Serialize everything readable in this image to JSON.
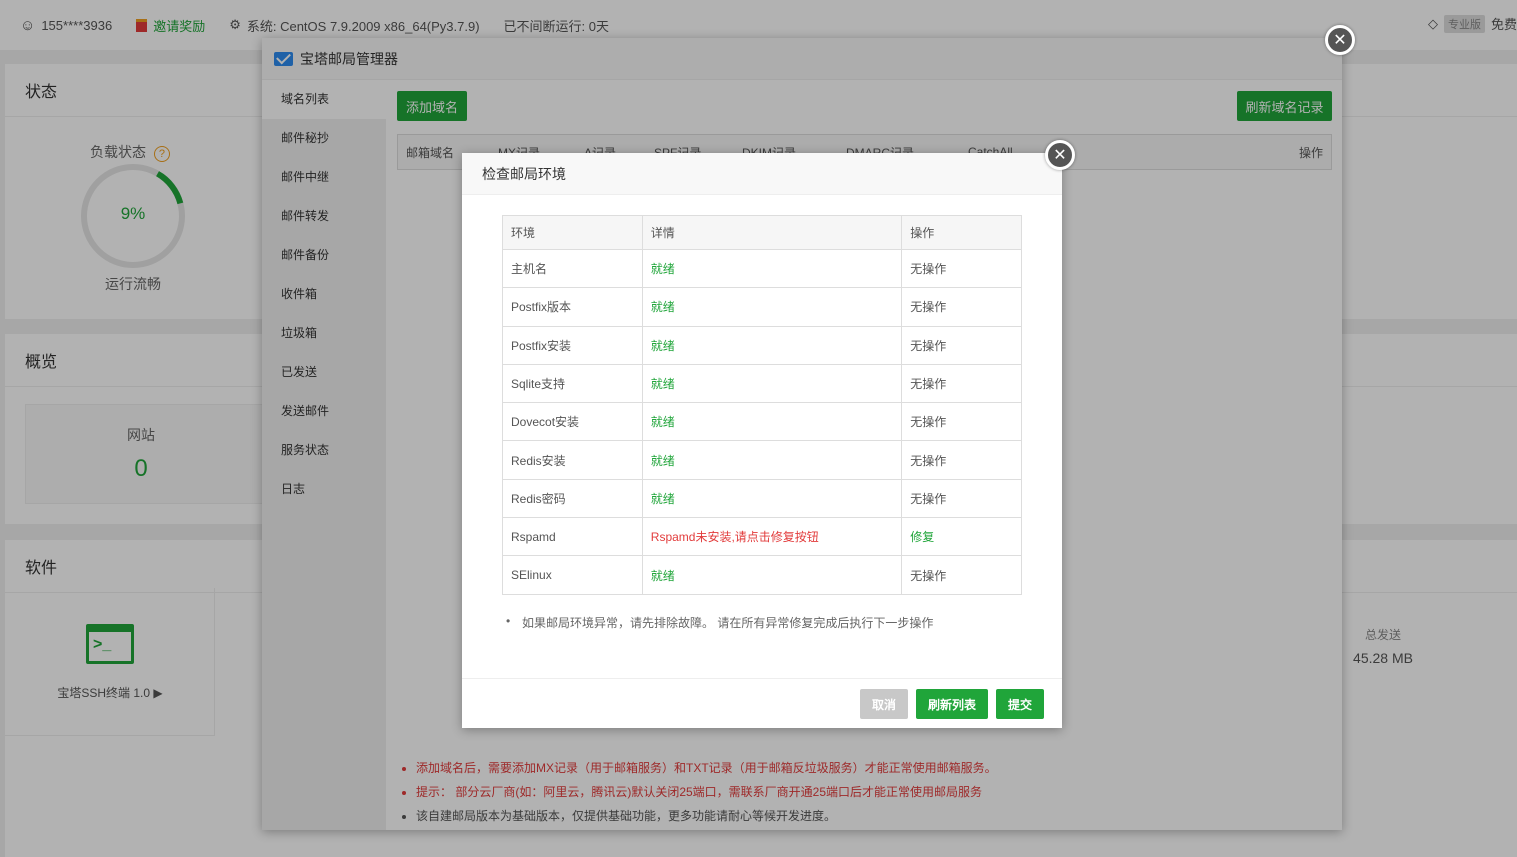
{
  "topbar": {
    "user": "155****3936",
    "invite": "邀请奖励",
    "system": "系统:   CentOS 7.9.2009 x86_64(Py3.7.9)",
    "uptime": "已不间断运行: 0天",
    "pro_tag": "专业版",
    "free": "免费"
  },
  "bg": {
    "status_title": "状态",
    "load_label": "负载状态",
    "load_value": "9%",
    "load_state": "运行流畅",
    "overview_title": "概览",
    "website_label": "网站",
    "website_count": "0",
    "software_title": "软件",
    "ssh_label": "宝塔SSH终端 1.0",
    "sent_label": "总发送",
    "sent_value": "45.28 MB"
  },
  "mail_manager": {
    "title": "宝塔邮局管理器",
    "side_items": [
      "域名列表",
      "邮件秘抄",
      "邮件中继",
      "邮件转发",
      "邮件备份",
      "收件箱",
      "垃圾箱",
      "已发送",
      "发送邮件",
      "服务状态",
      "日志"
    ],
    "add_domain": "添加域名",
    "refresh_dns": "刷新域名记录",
    "columns": [
      "邮箱域名",
      "MX记录",
      "A记录",
      "SPF记录",
      "DKIM记录",
      "DMARC记录",
      "CatchAll",
      "操作"
    ],
    "notes": [
      "添加域名后，需要添加MX记录（用于邮箱服务）和TXT记录（用于邮箱反垃圾服务）才能正常使用邮箱服务。",
      "提示： 部分云厂商(如：阿里云，腾讯云)默认关闭25端口，需联系厂商开通25端口后才能正常使用邮局服务",
      "该自建邮局版本为基础版本，仅提供基础功能，更多功能请耐心等候开发进度。"
    ]
  },
  "env_check": {
    "title": "检查邮局环境",
    "headers": [
      "环境",
      "详情",
      "操作"
    ],
    "rows": [
      {
        "env": "主机名",
        "detail": "就绪",
        "action": "无操作"
      },
      {
        "env": "Postfix版本",
        "detail": "就绪",
        "action": "无操作"
      },
      {
        "env": "Postfix安装",
        "detail": "就绪",
        "action": "无操作"
      },
      {
        "env": "Sqlite支持",
        "detail": "就绪",
        "action": "无操作"
      },
      {
        "env": "Dovecot安装",
        "detail": "就绪",
        "action": "无操作"
      },
      {
        "env": "Redis安装",
        "detail": "就绪",
        "action": "无操作"
      },
      {
        "env": "Redis密码",
        "detail": "就绪",
        "action": "无操作"
      },
      {
        "env": "Rspamd",
        "detail": "Rspamd未安装,请点击修复按钮",
        "action": "修复"
      },
      {
        "env": "SElinux",
        "detail": "就绪",
        "action": "无操作"
      }
    ],
    "tip": "如果邮局环境异常，请先排除故障。 请在所有异常修复完成后执行下一步操作",
    "cancel": "取消",
    "refresh": "刷新列表",
    "submit": "提交"
  },
  "colors": {
    "accent": "#20a53a",
    "error": "#e23c3c"
  }
}
